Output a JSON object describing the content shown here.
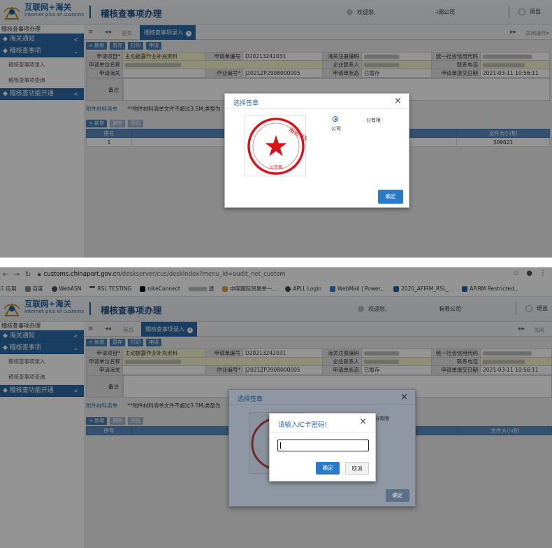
{
  "header": {
    "brand_cn": "互联网+海关",
    "brand_en": "internet plus of customs",
    "app_title": "稽核查事项办理",
    "welcome": "欢迎您,",
    "company_1": "-i调公司",
    "company_2": "有限公司'",
    "logout": "退出",
    "logout_2": "退出"
  },
  "browser": {
    "url_host": "customs.chinaport.gov.cn",
    "url_path": "/deskserver/cus/deskIndex?menu_id=audit_net_custom",
    "bookmarks": [
      "应用",
      "百度",
      "WebASN",
      "RSL TESTING",
      "nikeConnect",
      "遗",
      "中国国际贸易单一...",
      "APLL Login",
      "WebMail | Power...",
      "2020_AFIRM_RSL_...",
      "AFIRM Restricted..."
    ]
  },
  "sidebar": {
    "title": "稽核查事项办理",
    "items": [
      {
        "label": "海关通知"
      },
      {
        "label": "稽核查事项"
      },
      {
        "label": "稽核查事项录入"
      },
      {
        "label": "稽核查事项查询"
      },
      {
        "label": "稽核查功能开通"
      }
    ]
  },
  "tabs": {
    "home": "首页",
    "active": "稽核查事项录入",
    "ops": "关闭操作",
    "ops_2": "关闭"
  },
  "toolbar": {
    "add": "+ 新增",
    "save": "暂存",
    "print": "打印",
    "submit": "申请"
  },
  "form": {
    "apply_item_label": "申请项目*",
    "apply_item_value": "主动披露作业补充资料",
    "apply_no_label": "申请单编号",
    "apply_no_value": "D20213242031",
    "customs_reg_label": "海关注册编码",
    "credit_code_label": "统一社会信用代码",
    "apply_unit_label": "申请单位名称",
    "contact_label": "企业联系人",
    "phone_label": "联系电话",
    "customs_label": "申请海关",
    "job_no_label": "作业编号*",
    "job_no_value": "J2021ZP2908000005",
    "status_label": "申请单状态",
    "status_value": "已暂存",
    "submit_date_label": "申请单提交日期",
    "submit_date_value": "2021-03-11 10:56:11",
    "remark_label": "备注"
  },
  "attachments": {
    "title": "附件材料清单",
    "note": "**附件材料清单文件不超过3.5M,类型为",
    "add": "+ 新增",
    "delete": "删除",
    "preview": "预览",
    "headers": {
      "seq": "序号",
      "size": "文件大小(B)"
    },
    "rows": [
      {
        "seq": "1",
        "size": "309021"
      }
    ]
  },
  "seal_modal": {
    "title": "选择签章",
    "seal_text": "股份有限公司",
    "seal_label": "公司章",
    "radio_label": "公司",
    "company_fragment": "分有限",
    "company_fragment_2": "分有限",
    "ok": "确定",
    "close": "×"
  },
  "pin_modal": {
    "title": "请输入IC卡密码!",
    "ok": "确定",
    "cancel": "取消",
    "close": "×"
  },
  "colors": {
    "primary": "#2b6ca8",
    "seal_red": "#d8141b"
  }
}
